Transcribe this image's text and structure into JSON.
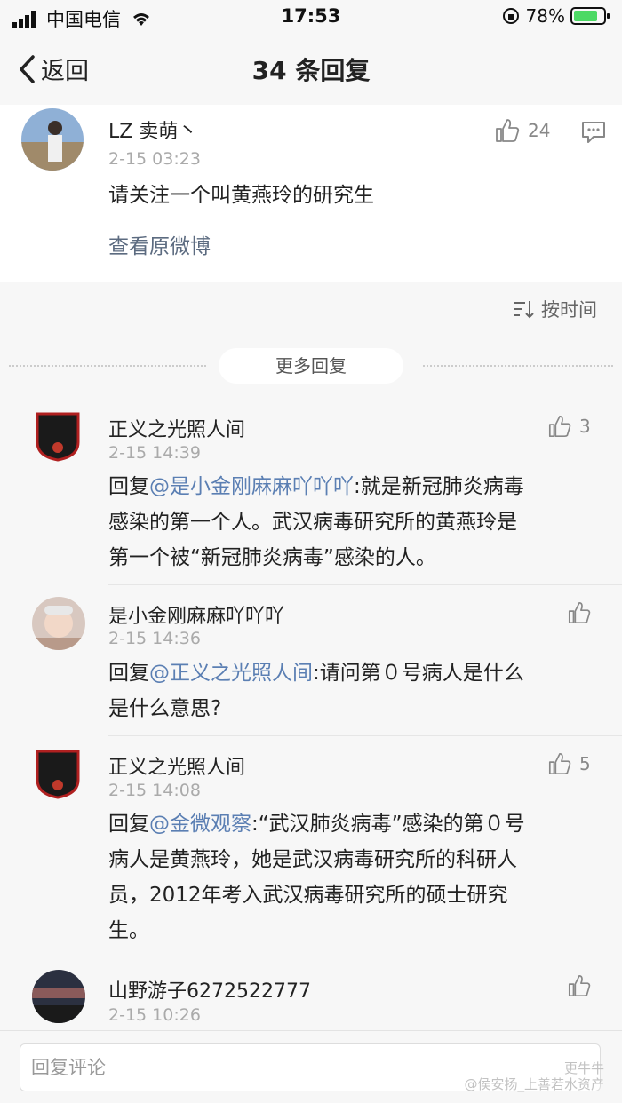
{
  "status_bar": {
    "carrier": "中国电信",
    "time": "17:53",
    "battery": "78%"
  },
  "nav": {
    "back_label": "返回",
    "title": "34 条回复"
  },
  "post": {
    "author": "LZ 卖萌丶",
    "time": "2-15 03:23",
    "likes": "24",
    "text": "请关注一个叫黄燕玲的研究生",
    "view_original": "查看原微博"
  },
  "sort": {
    "label": "按时间"
  },
  "more_replies": "更多回复",
  "comments": [
    {
      "author": "正义之光照人间",
      "time": "2-15 14:39",
      "likes": "3",
      "reply_prefix": "回复",
      "mention": "@是小金刚麻麻吖吖吖",
      "lines": [
        ":就是新冠肺炎病毒",
        "感染的第一个人。武汉病毒研究所的黄燕玲是",
        "第一个被“新冠肺炎病毒”感染的人。"
      ]
    },
    {
      "author": "是小金刚麻麻吖吖吖",
      "time": "2-15 14:36",
      "likes": "",
      "reply_prefix": "回复",
      "mention": "@正义之光照人间",
      "lines": [
        ":请问第０号病人是什么",
        "是什么意思?"
      ]
    },
    {
      "author": "正义之光照人间",
      "time": "2-15 14:08",
      "likes": "5",
      "reply_prefix": "回复",
      "mention": "@金微观察",
      "lines": [
        ":“武汉肺炎病毒”感染的第０号",
        "病人是黄燕玲，她是武汉病毒研究所的科研人",
        "员，2012年考入武汉病毒研究所的硕士研究",
        "生。"
      ]
    },
    {
      "author": "山野游子6272522777",
      "time": "2-15 10:26",
      "likes": ""
    }
  ],
  "comment_input": {
    "placeholder": "回复评论"
  },
  "watermark": {
    "line1": "更牛牛",
    "line2": "@侯安扬_上善若水资产"
  },
  "colors": {
    "mention": "#5b7fb3",
    "background": "#f7f7f7",
    "muted": "#aaaaaa"
  }
}
